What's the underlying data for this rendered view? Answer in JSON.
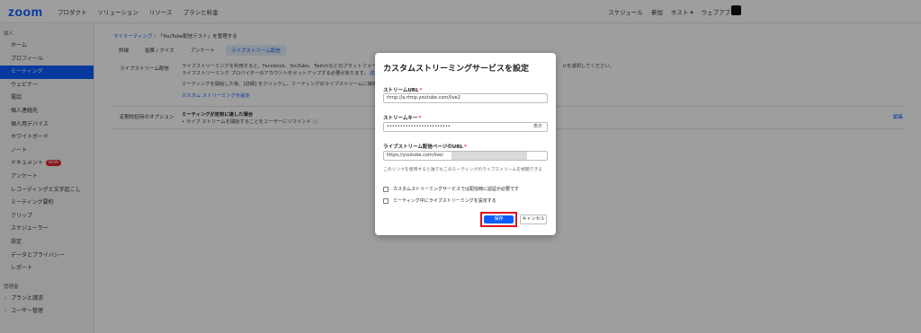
{
  "topbar": {
    "logo": "zoom",
    "nav": [
      "プロダクト",
      "ソリューション",
      "リソース",
      "プランと料金"
    ],
    "right": [
      "スケジュール",
      "参加",
      "ホスト ▾",
      "ウェブアプリ ▾"
    ]
  },
  "sidebar": {
    "section_personal": "個人",
    "items": [
      "ホーム",
      "プロフィール",
      "ミーティング",
      "ウェビナー",
      "電話",
      "個人連絡先",
      "個人用デバイス",
      "ホワイトボード",
      "ノート",
      "ドキュメント",
      "アンケート",
      "レコーディングと文字起こし",
      "ミーティング要約",
      "クリップ",
      "スケジューラー",
      "設定",
      "データとプライバシー",
      "レポート"
    ],
    "new_badge": "NEW",
    "section_admin": "管理者",
    "admin_items": [
      "プランと請求",
      "ユーザー管理"
    ]
  },
  "main": {
    "breadcrumb_link": "マイミーティング",
    "breadcrumb_rest": "›  「YouTube配信テスト」を管理する",
    "tabs": [
      "詳細",
      "投票 / クイズ",
      "アンケート",
      "ライブストリーム配信"
    ],
    "livestream_label": "ライブストリーム配信",
    "livestream_text1": "ライブストリーミングを利用すると、Facebook、YouTube、Twitchなどのプラットフォーム",
    "livestream_text1_right": "trを選択してください。",
    "livestream_text2": "ライブストリーミング プロバイダーのアカウントをセットアップする必要があります。",
    "livestream_text2_link": "詳細",
    "livestream_text3": "ミーティングを開始した後、[詳細] をクリックし、ミーティングのライブストリームに接続",
    "custom_link": "カスタム ストリーミングを設定",
    "interrupt_label": "定期的招待のオプション",
    "interrupt_title": "ミーティングが定刻に達した場合",
    "interrupt_sub": "•  ライブ ストリームを開始することをユーザーにリマインド ⓘ",
    "edit": "編集"
  },
  "dialog": {
    "title": "カスタムストリーミングサービスを設定",
    "url_label": "ストリームURL",
    "url_value": "rtmp://a.rtmp.youtube.com/live2",
    "key_label": "ストリームキー",
    "key_value": "••••••••••••••••••••••••",
    "key_show": "表示",
    "page_label": "ライブストリーム配信ページのURL",
    "page_value": "https://youtube.com/live/",
    "hint": "このリンクを使用すると誰でもこのミーティングのライブストリームを視聴できる",
    "check1": "カスタムストリーミングサービスでは配信時に認証が必要です",
    "check2": "ミーティング中にライブストリーミングを設定する",
    "save": "保存",
    "cancel": "キャンセル",
    "required_mark": "*"
  },
  "colors": {
    "accent": "#0b5cff",
    "highlight": "#e0101a",
    "required": "#e02828"
  }
}
